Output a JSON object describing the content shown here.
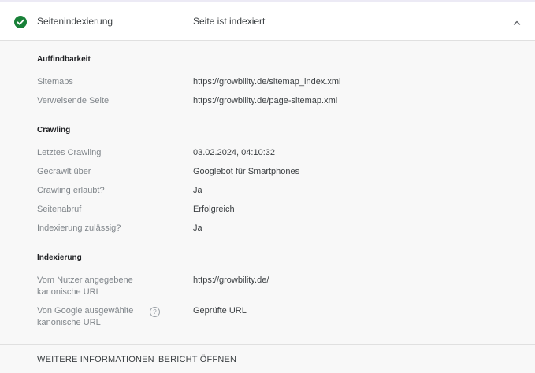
{
  "header": {
    "title": "Seitenindexierung",
    "status": "Seite ist indexiert",
    "status_icon": "check-circle-icon",
    "collapse_icon": "chevron-up-icon",
    "accent": "#188038"
  },
  "sections": {
    "discoverability": {
      "title": "Auffindbarkeit",
      "sitemaps_label": "Sitemaps",
      "sitemaps_value": "https://growbility.de/sitemap_index.xml",
      "referring_label": "Verweisende Seite",
      "referring_value": "https://growbility.de/page-sitemap.xml"
    },
    "crawling": {
      "title": "Crawling",
      "last_crawl_label": "Letztes Crawling",
      "last_crawl_value": "03.02.2024, 04:10:32",
      "crawled_as_label": "Gecrawlt über",
      "crawled_as_value": "Googlebot für Smartphones",
      "crawl_allowed_label": "Crawling erlaubt?",
      "crawl_allowed_value": "Ja",
      "page_fetch_label": "Seitenabruf",
      "page_fetch_value": "Erfolgreich",
      "indexing_allowed_label": "Indexierung zulässig?",
      "indexing_allowed_value": "Ja"
    },
    "indexing": {
      "title": "Indexierung",
      "user_canonical_label_1": "Vom Nutzer angegebene",
      "user_canonical_label_2": "kanonische URL",
      "user_canonical_value": "https://growbility.de/",
      "google_canonical_label_1": "Von Google ausgewählte",
      "google_canonical_label_2": "kanonische URL",
      "google_canonical_help": "?",
      "google_canonical_value": "Geprüfte URL"
    }
  },
  "footer": {
    "more_info": "WEITERE INFORMATIONEN",
    "open_report": "BERICHT ÖFFNEN"
  }
}
